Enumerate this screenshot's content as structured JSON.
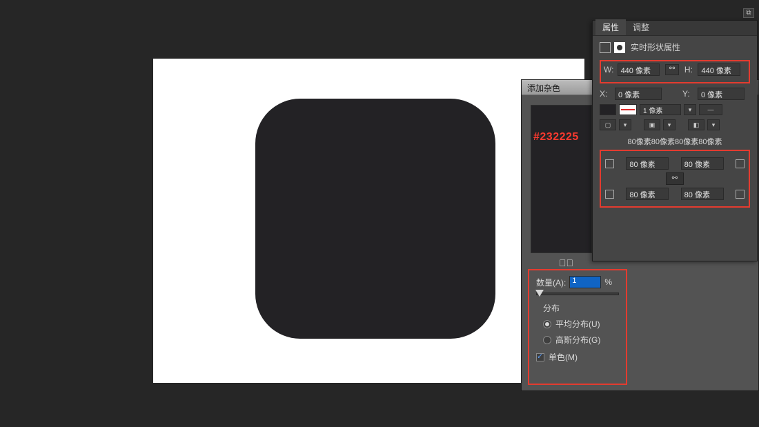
{
  "canvas": {
    "shape_color": "#232225",
    "shape_hex_label": "#232225"
  },
  "noise_panel": {
    "title": "添加杂色",
    "amount_label": "数量(A):",
    "amount_value": "1",
    "amount_unit": "%",
    "distribution_label": "分布",
    "uniform_label": "平均分布(U)",
    "gaussian_label": "高斯分布(G)",
    "mono_label": "单色(M)"
  },
  "properties": {
    "tab_active": "属性",
    "tab_inactive": "调整",
    "header": "实时形状属性",
    "w_label": "W:",
    "w_value": "440 像素",
    "h_label": "H:",
    "h_value": "440 像素",
    "x_label": "X:",
    "x_value": "0 像素",
    "y_label": "Y:",
    "y_value": "0 像素",
    "stroke_width": "1 像素",
    "corners_summary": "80像素80像素80像素80像素",
    "corner_tl": "80 像素",
    "corner_tr": "80 像素",
    "corner_bl": "80 像素",
    "corner_br": "80 像素"
  }
}
